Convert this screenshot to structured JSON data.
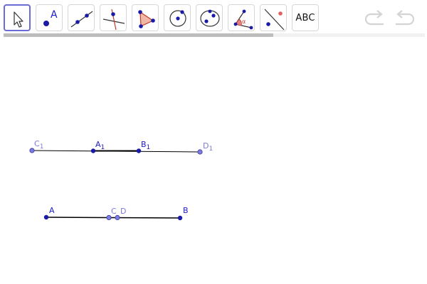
{
  "toolbar": {
    "tools": [
      {
        "name": "move",
        "icon": "arrow-cursor-icon",
        "selected": true
      },
      {
        "name": "point",
        "icon": "point-icon",
        "label": "A"
      },
      {
        "name": "line",
        "icon": "line-icon"
      },
      {
        "name": "perpendicular-line",
        "icon": "perpendicular-line-icon"
      },
      {
        "name": "polygon",
        "icon": "polygon-icon"
      },
      {
        "name": "circle",
        "icon": "circle-with-center-icon"
      },
      {
        "name": "ellipse",
        "icon": "ellipse-icon"
      },
      {
        "name": "angle",
        "icon": "angle-icon",
        "label": "α"
      },
      {
        "name": "reflect",
        "icon": "reflect-about-line-icon"
      },
      {
        "name": "text",
        "icon": "text-icon",
        "label": "ABC"
      }
    ],
    "undo": {
      "icon": "undo-icon"
    },
    "redo": {
      "icon": "redo-icon"
    }
  },
  "canvas": {
    "colors": {
      "point_dark": "#1a1aa8",
      "point_light": "#6b6bd8",
      "label_dark": "#1a1acc",
      "label_light": "#7b7be0",
      "segment": "#000000",
      "polygon_fill": "#f2b8a6",
      "angle_fill": "#e58080"
    },
    "labels": {
      "C1": {
        "main": "C",
        "sub": "1"
      },
      "A1": {
        "main": "A",
        "sub": "1"
      },
      "B1": {
        "main": "B",
        "sub": "1"
      },
      "D1": {
        "main": "D",
        "sub": "1"
      },
      "A": {
        "main": "A"
      },
      "C": {
        "main": "C"
      },
      "D": {
        "main": "D"
      },
      "B": {
        "main": "B"
      }
    }
  }
}
